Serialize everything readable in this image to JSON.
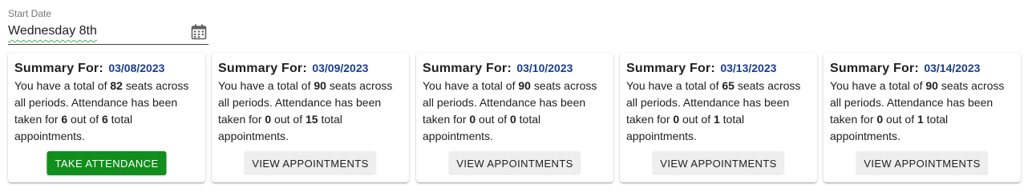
{
  "date_field": {
    "label": "Start Date",
    "value": "Wednesday 8th",
    "icon": "calendar-icon",
    "underline_color": "#4caf50"
  },
  "cards": [
    {
      "title": "Summary For:",
      "date": "03/08/2023",
      "text_1": "You have a total of ",
      "seats": "82",
      "text_2": " seats across all periods. Attendance has been taken for ",
      "taken": "6",
      "text_3": " out of ",
      "total": "6",
      "text_4": " total appointments.",
      "button": "TAKE ATTENDANCE",
      "button_style": "primary"
    },
    {
      "title": "Summary For:",
      "date": "03/09/2023",
      "text_1": "You have a total of ",
      "seats": "90",
      "text_2": " seats across all periods. Attendance has been taken for ",
      "taken": "0",
      "text_3": " out of ",
      "total": "15",
      "text_4": " total appointments.",
      "button": "VIEW APPOINTMENTS",
      "button_style": "secondary"
    },
    {
      "title": "Summary For:",
      "date": "03/10/2023",
      "text_1": "You have a total of ",
      "seats": "90",
      "text_2": " seats across all periods. Attendance has been taken for ",
      "taken": "0",
      "text_3": " out of ",
      "total": "0",
      "text_4": " total appointments.",
      "button": "VIEW APPOINTMENTS",
      "button_style": "secondary"
    },
    {
      "title": "Summary For:",
      "date": "03/13/2023",
      "text_1": "You have a total of ",
      "seats": "65",
      "text_2": " seats across all periods. Attendance has been taken for ",
      "taken": "0",
      "text_3": " out of ",
      "total": "1",
      "text_4": " total appointments.",
      "button": "VIEW APPOINTMENTS",
      "button_style": "secondary"
    },
    {
      "title": "Summary For:",
      "date": "03/14/2023",
      "text_1": "You have a total of ",
      "seats": "90",
      "text_2": " seats across all periods. Attendance has been taken for ",
      "taken": "0",
      "text_3": " out of ",
      "total": "1",
      "text_4": " total appointments.",
      "button": "VIEW APPOINTMENTS",
      "button_style": "secondary"
    }
  ],
  "colors": {
    "date_accent": "#1a3d8f",
    "primary_button": "#118e1b",
    "secondary_button": "#eeeeee"
  }
}
